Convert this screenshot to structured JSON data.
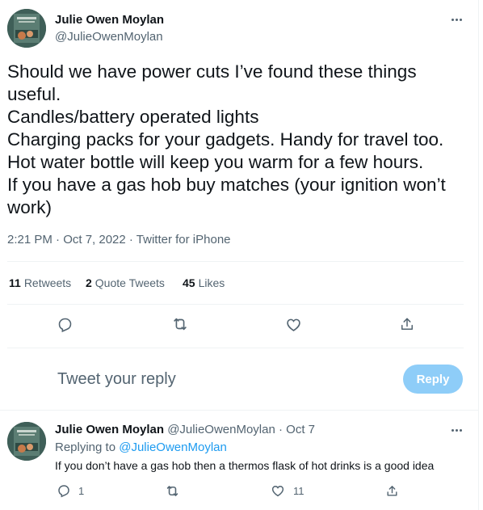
{
  "tweet": {
    "author_name": "Julie Owen Moylan",
    "author_handle": "@JulieOwenMoylan",
    "text_lines": [
      "Should we have power cuts I’ve found these things",
      "useful.",
      "Candles/battery operated lights",
      "Charging packs for your gadgets. Handy for travel too.",
      "Hot water bottle will keep you warm for a few hours.",
      "If you have a gas hob buy matches (your ignition won’t",
      "work)"
    ],
    "timestamp": "2:21 PM · Oct 7, 2022 · Twitter for iPhone",
    "stats": {
      "retweets_count": "11",
      "retweets_label": "Retweets",
      "quote_count": "2",
      "quote_label": "Quote Tweets",
      "likes_count": "45",
      "likes_label": "Likes"
    },
    "actions": [
      "reply-icon",
      "retweet-icon",
      "like-icon",
      "share-icon"
    ]
  },
  "composer": {
    "placeholder": "Tweet your reply",
    "button_label": "Reply"
  },
  "reply": {
    "author_name": "Julie Owen Moylan",
    "author_handle": "@JulieOwenMoylan",
    "separator": " · ",
    "date": "Oct 7",
    "replying_to_label": "Replying to ",
    "replying_to_handle": "@JulieOwenMoylan",
    "text": "If you don’t have a gas hob then a thermos flask of hot drinks is a good idea",
    "reply_count": "1",
    "like_count": "11"
  },
  "colors": {
    "accent": "#1d9bf0",
    "button_disabled": "#8ecdf8",
    "secondary_text": "#536471",
    "primary_text": "#0f1419",
    "divider": "#eff3f4"
  }
}
